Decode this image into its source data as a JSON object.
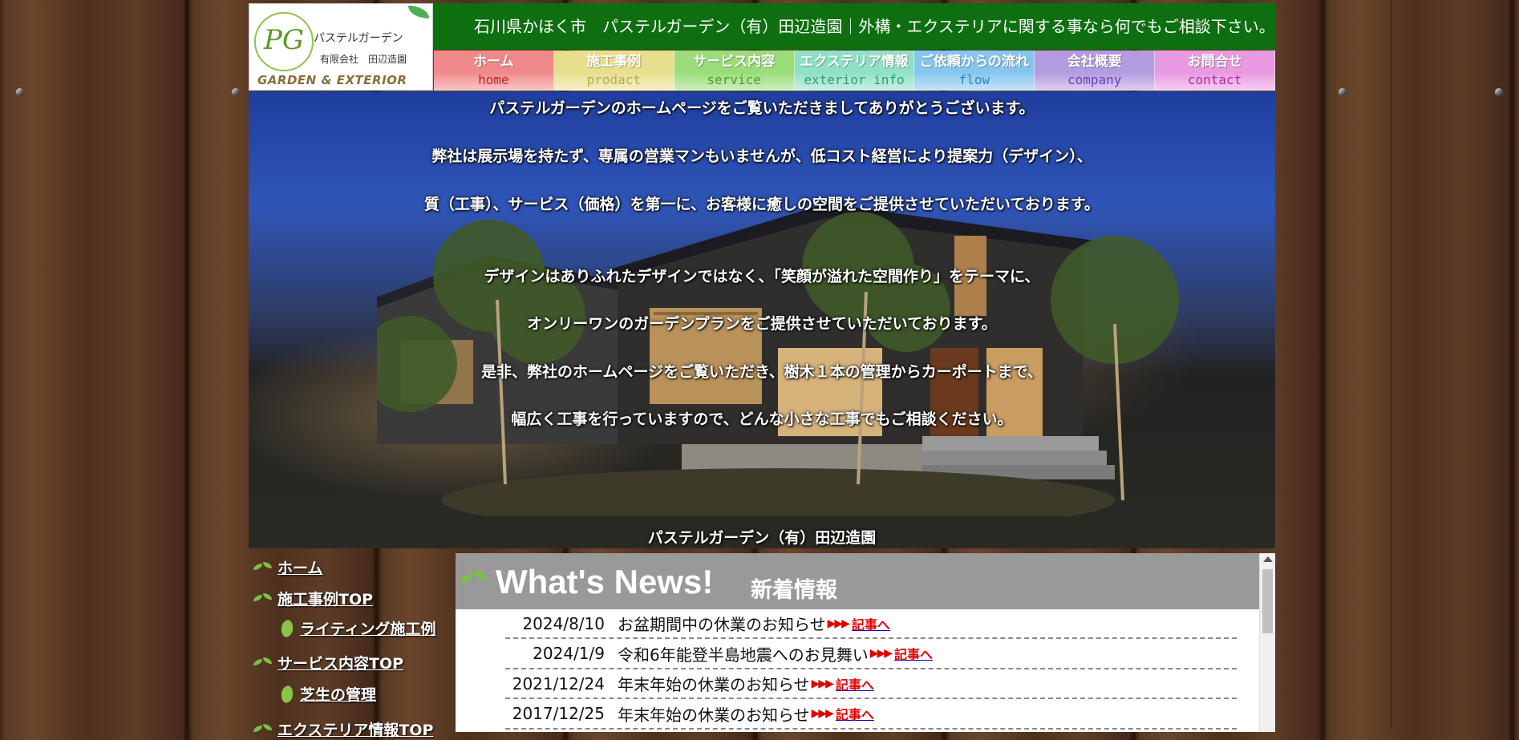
{
  "header": {
    "logo": {
      "monogram": "PG",
      "name_kana": "パステルガーデン",
      "company": "有限会社　田辺造園",
      "brand_en": "GARDEN & EXTERIOR"
    },
    "tagline": "石川県かほく市　パステルガーデン（有）田辺造園｜外構・エクステリアに関する事なら何でもご相談下さい。"
  },
  "nav": [
    {
      "label": "ホーム",
      "sub": "home",
      "color": "#f08a8a",
      "sub_color": "#d02020"
    },
    {
      "label": "施工事例",
      "sub": "prodact",
      "color": "#e8df8e",
      "sub_color": "#b9ad45"
    },
    {
      "label": "サービス内容",
      "sub": "service",
      "color": "#9bdc7a",
      "sub_color": "#4a9e2a"
    },
    {
      "label": "エクステリア情報",
      "sub": "exterior info",
      "color": "#8fe0c4",
      "sub_color": "#2a9e7a"
    },
    {
      "label": "ご依頼からの流れ",
      "sub": "flow",
      "color": "#86c6ee",
      "sub_color": "#2a82c0"
    },
    {
      "label": "会社概要",
      "sub": "company",
      "color": "#b39be0",
      "sub_color": "#6a40b8"
    },
    {
      "label": "お問合せ",
      "sub": "contact",
      "color": "#e89ae0",
      "sub_color": "#b02aa0"
    }
  ],
  "hero": {
    "lines": [
      "パステルガーデンのホームページをご覧いただきましてありがとうございます。",
      "弊社は展示場を持たず、専属の営業マンもいませんが、低コスト経営により提案力（デザイン）、",
      "質（工事）、サービス（価格）を第一に、お客様に癒しの空間をご提供させていただいております。",
      "デザインはありふれたデザインではなく、「笑顔が溢れた空間作り」をテーマに、",
      "オンリーワンのガーデンプランをご提供させていただいております。",
      "是非、弊社のホームページをご覧いただき、樹木１本の管理からカーポートまで、",
      "幅広く工事を行っていますので、どんな小さな工事でもご相談ください。"
    ],
    "caption": "パステルガーデン（有）田辺造園"
  },
  "sidebar": {
    "items": [
      {
        "label": "ホーム",
        "level": 0
      },
      {
        "label": "施工事例TOP",
        "level": 0
      },
      {
        "label": "ライティング施工例",
        "level": 1
      },
      {
        "label": "サービス内容TOP",
        "level": 0
      },
      {
        "label": "芝生の管理",
        "level": 1
      },
      {
        "label": "エクステリア情報TOP",
        "level": 0
      }
    ]
  },
  "news": {
    "title": "What's News!",
    "subtitle": "新着情報",
    "link_label": "記事へ",
    "arrows": "▶▶▶",
    "rows": [
      {
        "date": "2024/8/10",
        "text": "お盆期間中の休業のお知らせ"
      },
      {
        "date": "2024/1/9",
        "text": "令和6年能登半島地震へのお見舞い"
      },
      {
        "date": "2021/12/24",
        "text": "年末年始の休業のお知らせ"
      },
      {
        "date": "2017/12/25",
        "text": "年末年始の休業のお知らせ"
      }
    ]
  },
  "colors": {
    "tagline_bg": "#0d6f0f",
    "news_header_bg": "#999999",
    "hero_bottom_bar": "#3a5ad8",
    "link_red": "#e00000"
  }
}
